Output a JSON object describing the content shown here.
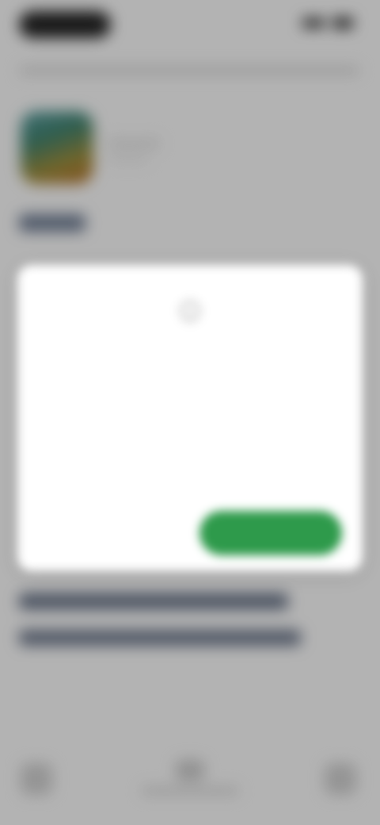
{
  "colors": {
    "primary_button": "#2e9a4b",
    "scrim": "rgba(0,0,0,0.26)",
    "dialog_bg": "#ffffff",
    "page_bg": "#f2f2f2"
  },
  "icons": {
    "dialog": "info-icon"
  },
  "dialog": {
    "title": "",
    "message": "",
    "note": "",
    "secondary_label": "",
    "primary_label": ""
  }
}
